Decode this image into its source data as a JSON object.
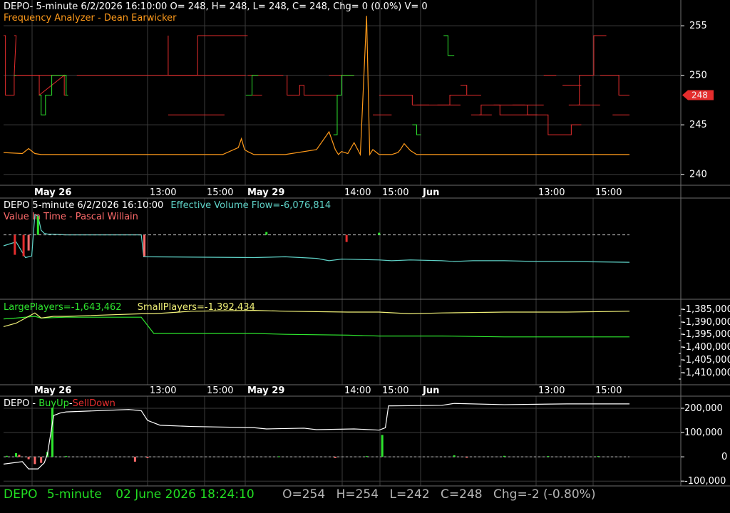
{
  "colors": {
    "bg": "#000000",
    "grid": "#3c3c3c",
    "divider": "#6e6e6e",
    "white": "#ffffff",
    "green": "#2ee52e",
    "red": "#e52d2d",
    "orange": "#ff9a1a",
    "yellow": "#f2f279",
    "cyan": "#5fd3c8",
    "pink": "#ff6b6b",
    "footer_green": "#22dd22",
    "footer_grey": "#b4b4b4"
  },
  "panel1": {
    "title": "DEPO- 5-minute 6/2/2026 16:10:00 O= 248, H= 248, L= 248, C= 248, Chg= 0 (0.0%) V= 0",
    "subtitle": "Frequency Analyzer - Dean Earwicker",
    "last_price_label": "248"
  },
  "panel2": {
    "title": "DEPO 5-minute  6/2/2026 16:10:00",
    "evf": "Effective Volume Flow=-6,076,814",
    "subtitle": "Value In Time - Pascal Willain"
  },
  "panel3": {
    "large": "LargePlayers=-1,643,462",
    "small": "SmallPlayers=-1,392,434"
  },
  "panel4": {
    "prefix": "DEPO - ",
    "buy": "BuyUp",
    "dash": "-",
    "sell": "SellDown"
  },
  "footer": {
    "symbol": "DEPO",
    "interval": "5-minute",
    "datetime": "02 June 2026 18:24:10",
    "o": "O=254",
    "h": "H=254",
    "l": "L=242",
    "c": "C=248",
    "chg": "Chg=-2 (-0.80%)"
  },
  "chart_data": [
    {
      "type": "line",
      "name": "price-panel",
      "x_axis_labels": [
        "May 26",
        "13:00",
        "15:00",
        "May 29",
        "14:00",
        "15:00",
        "Jun",
        "13:00",
        "15:00"
      ],
      "y_ticks": [
        255,
        250,
        245,
        240
      ],
      "ylim": [
        238.9,
        257.6
      ],
      "last_price": 248,
      "series": [
        {
          "color": "red",
          "segments": [
            {
              "x": [
                0.0,
                0.003,
                0.003,
                0.017,
                0.017,
                0.057,
                0.057,
                0.057,
                0.097,
                0.097,
                0.097,
                0.103
              ],
              "y": [
                254,
                254,
                248,
                248,
                250,
                250,
                248,
                248,
                250,
                250,
                248,
                248
              ]
            },
            {
              "x": [
                0.017,
                0.02,
                0.017,
                0.1
              ],
              "y": [
                254,
                254,
                250,
                250
              ]
            },
            {
              "x": [
                0.117,
                0.31,
                0.31,
                0.39
              ],
              "y": [
                250,
                250,
                254,
                254
              ]
            },
            {
              "x": [
                0.263,
                0.263,
                0.387
              ],
              "y": [
                254,
                250,
                250
              ]
            },
            {
              "x": [
                0.263,
                0.353
              ],
              "y": [
                246,
                246
              ]
            },
            {
              "x": [
                0.39,
                0.447
              ],
              "y": [
                250,
                250
              ]
            },
            {
              "x": [
                0.393,
                0.413
              ],
              "y": [
                248,
                248
              ]
            },
            {
              "x": [
                0.453,
                0.453,
                0.473,
                0.473,
                0.48,
                0.48,
                0.513
              ],
              "y": [
                250,
                248,
                248,
                249,
                249,
                248,
                248
              ]
            },
            {
              "x": [
                0.5,
                0.54
              ],
              "y": [
                248,
                248
              ]
            },
            {
              "x": [
                0.52,
                0.56
              ],
              "y": [
                250,
                250
              ]
            },
            {
              "x": [
                0.59,
                0.62
              ],
              "y": [
                246,
                246
              ]
            },
            {
              "x": [
                0.6,
                0.65
              ],
              "y": [
                248,
                248
              ]
            },
            {
              "x": [
                0.643,
                0.653,
                0.653
              ],
              "y": [
                248,
                248,
                247
              ]
            },
            {
              "x": [
                0.653,
                0.68
              ],
              "y": [
                247,
                247
              ]
            },
            {
              "x": [
                0.66,
                0.713,
                0.713,
                0.763
              ],
              "y": [
                247,
                247,
                248,
                248
              ]
            },
            {
              "x": [
                0.693,
                0.73
              ],
              "y": [
                247,
                247
              ]
            },
            {
              "x": [
                0.747,
                0.78
              ],
              "y": [
                246,
                246
              ]
            },
            {
              "x": [
                0.73,
                0.74,
                0.74,
                0.76
              ],
              "y": [
                249,
                249,
                248,
                248
              ]
            },
            {
              "x": [
                0.76,
                0.763,
                0.763,
                0.793,
                0.793,
                0.853
              ],
              "y": [
                246,
                246,
                247,
                247,
                246,
                246
              ]
            },
            {
              "x": [
                0.783,
                0.833
              ],
              "y": [
                247,
                247
              ]
            },
            {
              "x": [
                0.813,
                0.863
              ],
              "y": [
                247,
                247
              ]
            },
            {
              "x": [
                0.837,
                0.837,
                0.867
              ],
              "y": [
                247,
                246,
                246
              ]
            },
            {
              "x": [
                0.863,
                0.883
              ],
              "y": [
                250,
                250
              ]
            },
            {
              "x": [
                0.867,
                0.87,
                0.87,
                0.907,
                0.907,
                0.923
              ],
              "y": [
                246,
                246,
                244,
                244,
                245,
                245
              ]
            },
            {
              "x": [
                0.893,
                0.923
              ],
              "y": [
                249,
                249
              ]
            },
            {
              "x": [
                0.903,
                0.953
              ],
              "y": [
                247,
                247
              ]
            },
            {
              "x": [
                0.917,
                0.92,
                0.92,
                0.94
              ],
              "y": [
                247,
                247,
                250,
                250
              ]
            },
            {
              "x": [
                0.94,
                0.943,
                0.943,
                0.963
              ],
              "y": [
                250,
                250,
                254,
                254
              ]
            },
            {
              "x": [
                0.953,
                0.983,
                0.983,
                1.0
              ],
              "y": [
                250,
                250,
                248,
                248
              ]
            },
            {
              "x": [
                0.973,
                1.0
              ],
              "y": [
                246,
                246
              ]
            }
          ]
        },
        {
          "color": "green",
          "segments": [
            {
              "x": [
                0.017,
                0.02
              ],
              "y": [
                250,
                250
              ]
            },
            {
              "x": [
                0.057,
                0.06,
                0.06,
                0.067,
                0.067,
                0.077,
                0.077,
                0.1
              ],
              "y": [
                248,
                248,
                246,
                246,
                248,
                248,
                250,
                250
              ]
            },
            {
              "x": [
                0.097,
                0.1,
                0.1,
                0.103
              ],
              "y": [
                250,
                250,
                248,
                248
              ]
            },
            {
              "x": [
                0.387,
                0.397,
                0.397,
                0.407
              ],
              "y": [
                248,
                248,
                250,
                250
              ]
            },
            {
              "x": [
                0.527,
                0.533,
                0.533,
                0.54,
                0.54,
                0.56
              ],
              "y": [
                244,
                244,
                248,
                248,
                250,
                250
              ]
            },
            {
              "x": [
                0.653,
                0.66,
                0.66,
                0.667
              ],
              "y": [
                245,
                245,
                244,
                244
              ]
            },
            {
              "x": [
                0.703,
                0.71,
                0.71,
                0.72
              ],
              "y": [
                254,
                254,
                252,
                252
              ]
            }
          ]
        },
        {
          "color": "orange",
          "segments": [
            {
              "x": [
                0.0,
                0.03,
                0.04,
                0.05,
                0.06,
                0.1,
                0.2,
                0.3,
                0.35,
                0.375,
                0.38,
                0.385,
                0.39,
                0.4,
                0.45,
                0.5,
                0.52,
                0.53,
                0.535,
                0.54,
                0.55,
                0.56,
                0.57,
                0.58,
                0.585,
                0.59,
                0.6,
                0.62,
                0.63,
                0.634,
                0.64,
                0.65,
                0.66,
                0.7,
                0.8,
                0.9,
                1.0
              ],
              "y": [
                242.2,
                242.1,
                242.6,
                242.1,
                242,
                242,
                242,
                242,
                242,
                242.7,
                243.6,
                242.5,
                242.3,
                242,
                242,
                242.5,
                244.3,
                242.5,
                242,
                242.3,
                242.1,
                243.2,
                242,
                256,
                242,
                242.5,
                242,
                242,
                242.2,
                242.5,
                243.1,
                242.4,
                242,
                242,
                242,
                242,
                242
              ]
            }
          ]
        }
      ]
    },
    {
      "type": "line",
      "name": "value-in-time-panel",
      "series": [
        {
          "color": "cyan",
          "x": [
            0.0,
            0.02,
            0.035,
            0.045,
            0.05,
            0.055,
            0.06,
            0.065,
            0.07,
            0.1,
            0.2,
            0.22,
            0.224,
            0.4,
            0.45,
            0.5,
            0.52,
            0.54,
            0.6,
            0.62,
            0.65,
            0.7,
            0.72,
            0.75,
            0.8,
            0.85,
            0.9,
            1.0
          ],
          "y": [
            0.5,
            0.55,
            0.35,
            0.37,
            0.9,
            0.88,
            0.7,
            0.66,
            0.65,
            0.64,
            0.64,
            0.64,
            0.36,
            0.35,
            0.36,
            0.34,
            0.31,
            0.33,
            0.32,
            0.31,
            0.32,
            0.31,
            0.3,
            0.31,
            0.31,
            0.3,
            0.3,
            0.29
          ]
        },
        {
          "color": "white_dashed",
          "x": [
            0.0,
            1.0
          ],
          "y": [
            0.64,
            0.64
          ]
        }
      ]
    },
    {
      "type": "line",
      "name": "players-panel",
      "y_ticks": [
        "1,385,000",
        "1,390,000",
        "1,395,000",
        "1,400,000",
        "1,405,000",
        "1,410,000"
      ],
      "series": [
        {
          "name": "LargePlayers",
          "color": "green",
          "x": [
            0.0,
            0.02,
            0.05,
            0.06,
            0.1,
            0.22,
            0.24,
            0.35,
            0.4,
            0.45,
            0.55,
            0.6,
            0.65,
            0.7,
            0.8,
            0.9,
            1.0
          ],
          "y": [
            0.77,
            0.78,
            0.8,
            0.78,
            0.79,
            0.79,
            0.6,
            0.6,
            0.6,
            0.59,
            0.58,
            0.57,
            0.57,
            0.57,
            0.56,
            0.56,
            0.56
          ]
        },
        {
          "name": "SmallPlayers",
          "color": "yellow",
          "x": [
            0.0,
            0.02,
            0.05,
            0.06,
            0.08,
            0.1,
            0.22,
            0.24,
            0.3,
            0.4,
            0.45,
            0.55,
            0.6,
            0.65,
            0.7,
            0.8,
            0.9,
            1.0
          ],
          "y": [
            0.68,
            0.72,
            0.84,
            0.78,
            0.8,
            0.8,
            0.83,
            0.83,
            0.86,
            0.87,
            0.86,
            0.85,
            0.85,
            0.83,
            0.84,
            0.85,
            0.85,
            0.86
          ]
        }
      ]
    },
    {
      "type": "line",
      "name": "buyup-selldown-panel",
      "x_axis_labels": [
        "May 26",
        "13:00",
        "15:00",
        "May 29",
        "14:00",
        "15:00",
        "Jun",
        "13:00",
        "15:00"
      ],
      "y_ticks": [
        "200,000",
        "100,000",
        "0",
        "-100,000"
      ],
      "ylim": [
        -120000,
        250000
      ],
      "series": [
        {
          "color": "white",
          "x": [
            0.0,
            0.03,
            0.04,
            0.055,
            0.065,
            0.07,
            0.08,
            0.09,
            0.1,
            0.15,
            0.2,
            0.22,
            0.23,
            0.25,
            0.3,
            0.4,
            0.42,
            0.48,
            0.5,
            0.56,
            0.6,
            0.61,
            0.615,
            0.62,
            0.7,
            0.72,
            0.8,
            0.9,
            1.0
          ],
          "y": [
            -30000,
            -20000,
            -50000,
            -50000,
            -25000,
            10000,
            170000,
            180000,
            185000,
            190000,
            195000,
            190000,
            150000,
            130000,
            125000,
            120000,
            115000,
            118000,
            112000,
            115000,
            110000,
            120000,
            210000,
            210000,
            212000,
            220000,
            215000,
            218000,
            218000
          ]
        }
      ],
      "volume_bars": [
        {
          "x": 0.005,
          "v": 4000,
          "c": "green"
        },
        {
          "x": 0.02,
          "v": 15000,
          "c": "green"
        },
        {
          "x": 0.025,
          "v": 8000,
          "c": "red"
        },
        {
          "x": 0.04,
          "v": -10000,
          "c": "red"
        },
        {
          "x": 0.05,
          "v": -30000,
          "c": "red"
        },
        {
          "x": 0.06,
          "v": -25000,
          "c": "red"
        },
        {
          "x": 0.07,
          "v": 20000,
          "c": "green"
        },
        {
          "x": 0.078,
          "v": 200000,
          "c": "green"
        },
        {
          "x": 0.1,
          "v": 3000,
          "c": "green"
        },
        {
          "x": 0.21,
          "v": -20000,
          "c": "red"
        },
        {
          "x": 0.23,
          "v": -5000,
          "c": "red"
        },
        {
          "x": 0.44,
          "v": 2000,
          "c": "green"
        },
        {
          "x": 0.53,
          "v": -5000,
          "c": "red"
        },
        {
          "x": 0.58,
          "v": 3000,
          "c": "green"
        },
        {
          "x": 0.605,
          "v": 90000,
          "c": "green"
        },
        {
          "x": 0.72,
          "v": 6000,
          "c": "green"
        },
        {
          "x": 0.74,
          "v": -4000,
          "c": "red"
        },
        {
          "x": 0.8,
          "v": 4000,
          "c": "green"
        },
        {
          "x": 0.87,
          "v": 3000,
          "c": "green"
        },
        {
          "x": 0.95,
          "v": 3000,
          "c": "green"
        }
      ]
    }
  ]
}
